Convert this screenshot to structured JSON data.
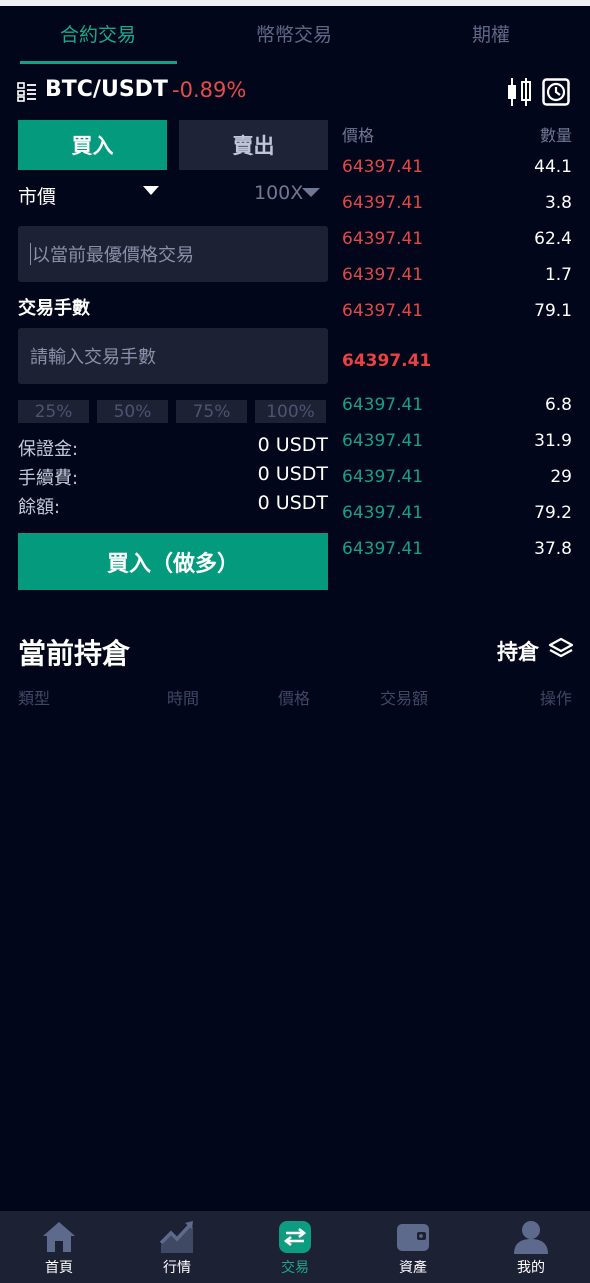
{
  "tabs": [
    {
      "label": "合約交易",
      "active": true
    },
    {
      "label": "幣幣交易",
      "active": false
    },
    {
      "label": "期權",
      "active": false
    }
  ],
  "pair": {
    "symbol": "BTC/USDT",
    "change": "-0.89%",
    "icons": [
      "menu-grid-icon",
      "kline-chart-icon",
      "history-clock-icon"
    ]
  },
  "order_form": {
    "buy_tab": "買入",
    "sell_tab": "賣出",
    "order_type": "市價",
    "leverage": "100X",
    "price_placeholder": "以當前最優價格交易",
    "lots_label": "交易手數",
    "lots_placeholder": "請輸入交易手數",
    "percent_buttons": [
      "25%",
      "50%",
      "75%",
      "100%"
    ],
    "info": [
      {
        "label": "保證金:",
        "value": "0 USDT"
      },
      {
        "label": "手續費:",
        "value": "0 USDT"
      },
      {
        "label": "餘額:",
        "value": "0 USDT"
      }
    ],
    "submit_label": "買入（做多）"
  },
  "orderbook": {
    "price_header": "價格",
    "qty_header": "數量",
    "asks": [
      {
        "price": "64397.41",
        "qty": "44.1"
      },
      {
        "price": "64397.41",
        "qty": "3.8"
      },
      {
        "price": "64397.41",
        "qty": "62.4"
      },
      {
        "price": "64397.41",
        "qty": "1.7"
      },
      {
        "price": "64397.41",
        "qty": "79.1"
      }
    ],
    "last_price": "64397.41",
    "bids": [
      {
        "price": "64397.41",
        "qty": "6.8"
      },
      {
        "price": "64397.41",
        "qty": "31.9"
      },
      {
        "price": "64397.41",
        "qty": "29"
      },
      {
        "price": "64397.41",
        "qty": "79.2"
      },
      {
        "price": "64397.41",
        "qty": "37.8"
      }
    ]
  },
  "positions": {
    "title": "當前持倉",
    "link": "持倉",
    "columns": [
      "類型",
      "時間",
      "價格",
      "交易額",
      "操作"
    ]
  },
  "bottom_nav": [
    {
      "label": "首頁",
      "icon": "home-icon",
      "active": false
    },
    {
      "label": "行情",
      "icon": "market-chart-icon",
      "active": false
    },
    {
      "label": "交易",
      "icon": "exchange-icon",
      "active": true
    },
    {
      "label": "資產",
      "icon": "wallet-icon",
      "active": false
    },
    {
      "label": "我的",
      "icon": "user-icon",
      "active": false
    }
  ],
  "colors": {
    "accent": "#049a7d",
    "ask_red": "#e04848",
    "bid_green": "#17a084",
    "background": "#02061a"
  }
}
